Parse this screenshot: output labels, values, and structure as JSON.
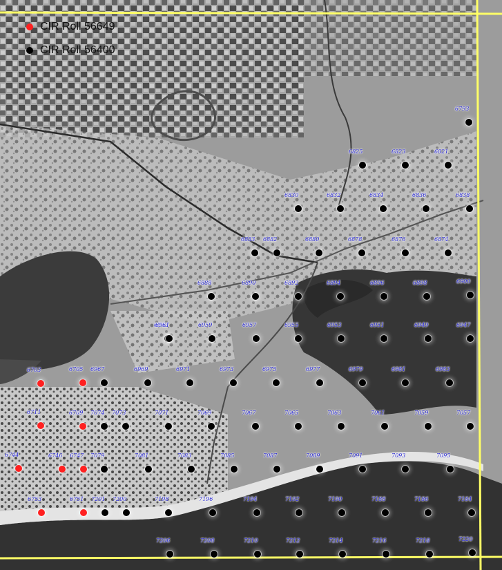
{
  "legend": {
    "items": [
      {
        "label": "CIR Roll 56649",
        "color": "#ff2020"
      },
      {
        "label": "CIR Roll 56400",
        "color": "#000000"
      }
    ]
  },
  "colors": {
    "water": "#3a3a3a",
    "land": "#9a9a9a",
    "marsh": "#cfcfcf",
    "grid_line": "#ffff66",
    "label_text": "#1818cc"
  },
  "markers": [
    {
      "label": "6793",
      "roll": "56400"
    },
    {
      "label": "6825",
      "roll": "56400"
    },
    {
      "label": "6823",
      "roll": "56400"
    },
    {
      "label": "6821",
      "roll": "56400"
    },
    {
      "label": "6830",
      "roll": "56400"
    },
    {
      "label": "6832",
      "roll": "56400"
    },
    {
      "label": "6834",
      "roll": "56400"
    },
    {
      "label": "6836",
      "roll": "56400"
    },
    {
      "label": "6838",
      "roll": "56400"
    },
    {
      "label": "6883",
      "roll": "56400"
    },
    {
      "label": "6882",
      "roll": "56400"
    },
    {
      "label": "6880",
      "roll": "56400"
    },
    {
      "label": "6878",
      "roll": "56400"
    },
    {
      "label": "6876",
      "roll": "56400"
    },
    {
      "label": "6874",
      "roll": "56400"
    },
    {
      "label": "6888",
      "roll": "56400"
    },
    {
      "label": "6890",
      "roll": "56400"
    },
    {
      "label": "6892",
      "roll": "56400"
    },
    {
      "label": "6894",
      "roll": "56400"
    },
    {
      "label": "6896",
      "roll": "56400"
    },
    {
      "label": "6898",
      "roll": "56400"
    },
    {
      "label": "6900",
      "roll": "56400"
    },
    {
      "label": "6962",
      "roll": "56400"
    },
    {
      "label": "6961",
      "roll": "56400"
    },
    {
      "label": "6959",
      "roll": "56400"
    },
    {
      "label": "6957",
      "roll": "56400"
    },
    {
      "label": "6955",
      "roll": "56400"
    },
    {
      "label": "6953",
      "roll": "56400"
    },
    {
      "label": "6951",
      "roll": "56400"
    },
    {
      "label": "6949",
      "roll": "56400"
    },
    {
      "label": "6947",
      "roll": "56400"
    },
    {
      "label": "6703",
      "roll": "56649"
    },
    {
      "label": "6705",
      "roll": "56649"
    },
    {
      "label": "6967",
      "roll": "56400"
    },
    {
      "label": "6969",
      "roll": "56400"
    },
    {
      "label": "6971",
      "roll": "56400"
    },
    {
      "label": "6973",
      "roll": "56400"
    },
    {
      "label": "6975",
      "roll": "56400"
    },
    {
      "label": "6977",
      "roll": "56400"
    },
    {
      "label": "6979",
      "roll": "56400"
    },
    {
      "label": "6981",
      "roll": "56400"
    },
    {
      "label": "6983",
      "roll": "56400"
    },
    {
      "label": "6711",
      "roll": "56649"
    },
    {
      "label": "6709",
      "roll": "56649"
    },
    {
      "label": "7074",
      "roll": "56400"
    },
    {
      "label": "7073",
      "roll": "56400"
    },
    {
      "label": "7071",
      "roll": "56400"
    },
    {
      "label": "7069",
      "roll": "56400"
    },
    {
      "label": "7067",
      "roll": "56400"
    },
    {
      "label": "7065",
      "roll": "56400"
    },
    {
      "label": "7063",
      "roll": "56400"
    },
    {
      "label": "7061",
      "roll": "56400"
    },
    {
      "label": "7059",
      "roll": "56400"
    },
    {
      "label": "7057",
      "roll": "56400"
    },
    {
      "label": "6744",
      "roll": "56649"
    },
    {
      "label": "6746",
      "roll": "56649"
    },
    {
      "label": "6747",
      "roll": "56649"
    },
    {
      "label": "7079",
      "roll": "56400"
    },
    {
      "label": "7081",
      "roll": "56400"
    },
    {
      "label": "7083",
      "roll": "56400"
    },
    {
      "label": "7085",
      "roll": "56400"
    },
    {
      "label": "7087",
      "roll": "56400"
    },
    {
      "label": "7089",
      "roll": "56400"
    },
    {
      "label": "7091",
      "roll": "56400"
    },
    {
      "label": "7093",
      "roll": "56400"
    },
    {
      "label": "7095",
      "roll": "56400"
    },
    {
      "label": "6753",
      "roll": "56649"
    },
    {
      "label": "6751",
      "roll": "56649"
    },
    {
      "label": "7201",
      "roll": "56400"
    },
    {
      "label": "7200",
      "roll": "56400"
    },
    {
      "label": "7198",
      "roll": "56400"
    },
    {
      "label": "7196",
      "roll": "56400"
    },
    {
      "label": "7194",
      "roll": "56400"
    },
    {
      "label": "7192",
      "roll": "56400"
    },
    {
      "label": "7190",
      "roll": "56400"
    },
    {
      "label": "7188",
      "roll": "56400"
    },
    {
      "label": "7186",
      "roll": "56400"
    },
    {
      "label": "7184",
      "roll": "56400"
    },
    {
      "label": "7206",
      "roll": "56400"
    },
    {
      "label": "7208",
      "roll": "56400"
    },
    {
      "label": "7210",
      "roll": "56400"
    },
    {
      "label": "7212",
      "roll": "56400"
    },
    {
      "label": "7214",
      "roll": "56400"
    },
    {
      "label": "7216",
      "roll": "56400"
    },
    {
      "label": "7218",
      "roll": "56400"
    },
    {
      "label": "7220",
      "roll": "56400"
    }
  ]
}
